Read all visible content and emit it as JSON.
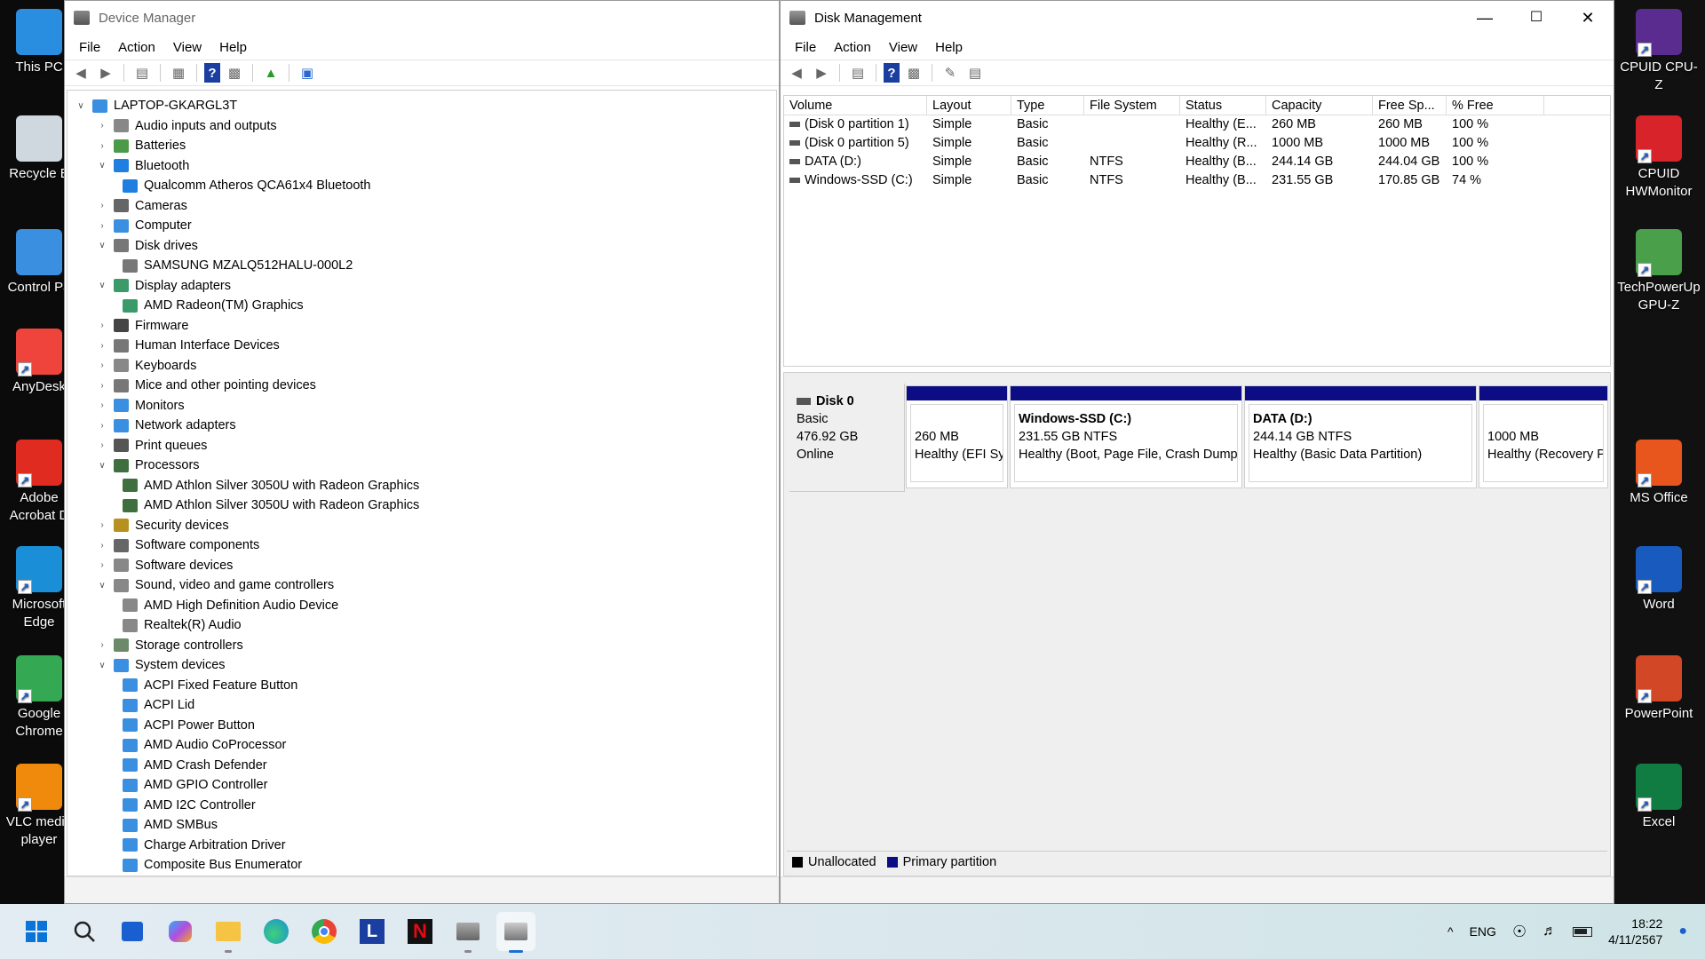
{
  "desktop": {
    "left_icons": [
      {
        "label": "This PC",
        "icon": "this-pc-icon",
        "color": "#2a8ee0"
      },
      {
        "label": "Recycle B",
        "icon": "recycle-bin-icon",
        "color": "#cfd8de"
      },
      {
        "label": "Control Pa",
        "icon": "control-panel-icon",
        "color": "#3a8fe0"
      },
      {
        "label": "AnyDesk",
        "icon": "anydesk-icon",
        "color": "#ef443b"
      },
      {
        "label": "Adobe Acrobat D",
        "icon": "adobe-acrobat-icon",
        "color": "#e02b20"
      },
      {
        "label": "Microsoft Edge",
        "icon": "edge-icon",
        "color": "#1a8fd8"
      },
      {
        "label": "Google Chrome",
        "icon": "chrome-icon",
        "color": "#34a853"
      },
      {
        "label": "VLC media player",
        "icon": "vlc-icon",
        "color": "#f08a0c"
      }
    ],
    "right_icons": [
      {
        "label": "CPUID CPU-Z",
        "icon": "cpuz-icon",
        "color": "#5b2c8f"
      },
      {
        "label": "CPUID HWMonitor",
        "icon": "hwmonitor-icon",
        "color": "#d8232a"
      },
      {
        "label": "TechPowerUp GPU-Z",
        "icon": "gpuz-icon",
        "color": "#4aa04a"
      },
      {
        "label": "MS Office",
        "icon": "office-icon",
        "color": "#e8551d"
      },
      {
        "label": "Word",
        "icon": "word-icon",
        "color": "#185abd"
      },
      {
        "label": "PowerPoint",
        "icon": "powerpoint-icon",
        "color": "#d24726"
      },
      {
        "label": "Excel",
        "icon": "excel-icon",
        "color": "#107c41"
      }
    ]
  },
  "device_manager": {
    "title": "Device Manager",
    "menu": [
      "File",
      "Action",
      "View",
      "Help"
    ],
    "root": "LAPTOP-GKARGL3T",
    "tree": [
      {
        "label": "Audio inputs and outputs",
        "level": 1,
        "state": "collapsed",
        "color": "#888"
      },
      {
        "label": "Batteries",
        "level": 1,
        "state": "collapsed",
        "color": "#4a9a4a"
      },
      {
        "label": "Bluetooth",
        "level": 1,
        "state": "expanded",
        "color": "#1e7fe0"
      },
      {
        "label": "Qualcomm Atheros QCA61x4 Bluetooth",
        "level": 2,
        "state": "leaf",
        "color": "#1e7fe0"
      },
      {
        "label": "Cameras",
        "level": 1,
        "state": "collapsed",
        "color": "#666"
      },
      {
        "label": "Computer",
        "level": 1,
        "state": "collapsed",
        "color": "#3a8fe0"
      },
      {
        "label": "Disk drives",
        "level": 1,
        "state": "expanded",
        "color": "#777"
      },
      {
        "label": "SAMSUNG MZALQ512HALU-000L2",
        "level": 2,
        "state": "leaf",
        "color": "#777"
      },
      {
        "label": "Display adapters",
        "level": 1,
        "state": "expanded",
        "color": "#3a9a6a"
      },
      {
        "label": "AMD Radeon(TM) Graphics",
        "level": 2,
        "state": "leaf",
        "color": "#3a9a6a"
      },
      {
        "label": "Firmware",
        "level": 1,
        "state": "collapsed",
        "color": "#444"
      },
      {
        "label": "Human Interface Devices",
        "level": 1,
        "state": "collapsed",
        "color": "#777"
      },
      {
        "label": "Keyboards",
        "level": 1,
        "state": "collapsed",
        "color": "#888"
      },
      {
        "label": "Mice and other pointing devices",
        "level": 1,
        "state": "collapsed",
        "color": "#777"
      },
      {
        "label": "Monitors",
        "level": 1,
        "state": "collapsed",
        "color": "#3a8fe0"
      },
      {
        "label": "Network adapters",
        "level": 1,
        "state": "collapsed",
        "color": "#3a8fe0"
      },
      {
        "label": "Print queues",
        "level": 1,
        "state": "collapsed",
        "color": "#555"
      },
      {
        "label": "Processors",
        "level": 1,
        "state": "expanded",
        "color": "#3f6f3f"
      },
      {
        "label": "AMD Athlon Silver 3050U with Radeon Graphics",
        "level": 2,
        "state": "leaf",
        "color": "#3f6f3f"
      },
      {
        "label": "AMD Athlon Silver 3050U with Radeon Graphics",
        "level": 2,
        "state": "leaf",
        "color": "#3f6f3f"
      },
      {
        "label": "Security devices",
        "level": 1,
        "state": "collapsed",
        "color": "#b89020"
      },
      {
        "label": "Software components",
        "level": 1,
        "state": "collapsed",
        "color": "#666"
      },
      {
        "label": "Software devices",
        "level": 1,
        "state": "collapsed",
        "color": "#888"
      },
      {
        "label": "Sound, video and game controllers",
        "level": 1,
        "state": "expanded",
        "color": "#888"
      },
      {
        "label": "AMD High Definition Audio Device",
        "level": 2,
        "state": "leaf",
        "color": "#888"
      },
      {
        "label": "Realtek(R) Audio",
        "level": 2,
        "state": "leaf",
        "color": "#888"
      },
      {
        "label": "Storage controllers",
        "level": 1,
        "state": "collapsed",
        "color": "#6a8a6a"
      },
      {
        "label": "System devices",
        "level": 1,
        "state": "expanded",
        "color": "#3a8fe0"
      },
      {
        "label": "ACPI Fixed Feature Button",
        "level": 2,
        "state": "leaf",
        "color": "#3a8fe0"
      },
      {
        "label": "ACPI Lid",
        "level": 2,
        "state": "leaf",
        "color": "#3a8fe0"
      },
      {
        "label": "ACPI Power Button",
        "level": 2,
        "state": "leaf",
        "color": "#3a8fe0"
      },
      {
        "label": "AMD Audio CoProcessor",
        "level": 2,
        "state": "leaf",
        "color": "#3a8fe0"
      },
      {
        "label": "AMD Crash Defender",
        "level": 2,
        "state": "leaf",
        "color": "#3a8fe0"
      },
      {
        "label": "AMD GPIO Controller",
        "level": 2,
        "state": "leaf",
        "color": "#3a8fe0"
      },
      {
        "label": "AMD I2C Controller",
        "level": 2,
        "state": "leaf",
        "color": "#3a8fe0"
      },
      {
        "label": "AMD SMBus",
        "level": 2,
        "state": "leaf",
        "color": "#3a8fe0"
      },
      {
        "label": "Charge Arbitration Driver",
        "level": 2,
        "state": "leaf",
        "color": "#3a8fe0"
      },
      {
        "label": "Composite Bus Enumerator",
        "level": 2,
        "state": "leaf",
        "color": "#3a8fe0"
      }
    ]
  },
  "disk_management": {
    "title": "Disk Management",
    "menu": [
      "File",
      "Action",
      "View",
      "Help"
    ],
    "columns": [
      "Volume",
      "Layout",
      "Type",
      "File System",
      "Status",
      "Capacity",
      "Free Sp...",
      "% Free"
    ],
    "rows": [
      [
        "(Disk 0 partition 1)",
        "Simple",
        "Basic",
        "",
        "Healthy (E...",
        "260 MB",
        "260 MB",
        "100 %"
      ],
      [
        "(Disk 0 partition 5)",
        "Simple",
        "Basic",
        "",
        "Healthy (R...",
        "1000 MB",
        "1000 MB",
        "100 %"
      ],
      [
        "DATA (D:)",
        "Simple",
        "Basic",
        "NTFS",
        "Healthy (B...",
        "244.14 GB",
        "244.04 GB",
        "100 %"
      ],
      [
        "Windows-SSD (C:)",
        "Simple",
        "Basic",
        "NTFS",
        "Healthy (B...",
        "231.55 GB",
        "170.85 GB",
        "74 %"
      ]
    ],
    "disk": {
      "name": "Disk 0",
      "type": "Basic",
      "size": "476.92 GB",
      "status": "Online"
    },
    "partitions": [
      {
        "name": "",
        "size": "260 MB",
        "status": "Healthy (EFI Sy"
      },
      {
        "name": "Windows-SSD  (C:)",
        "size": "231.55 GB NTFS",
        "status": "Healthy (Boot, Page File, Crash Dump"
      },
      {
        "name": "DATA  (D:)",
        "size": "244.14 GB NTFS",
        "status": "Healthy (Basic Data Partition)"
      },
      {
        "name": "",
        "size": "1000 MB",
        "status": "Healthy (Recovery P"
      }
    ],
    "legend": {
      "unallocated": "Unallocated",
      "primary": "Primary partition",
      "unallocated_color": "#000000",
      "primary_color": "#0c0c84"
    }
  },
  "taskbar": {
    "lang": "ENG",
    "time": "18:22",
    "date": "4/11/2567"
  }
}
